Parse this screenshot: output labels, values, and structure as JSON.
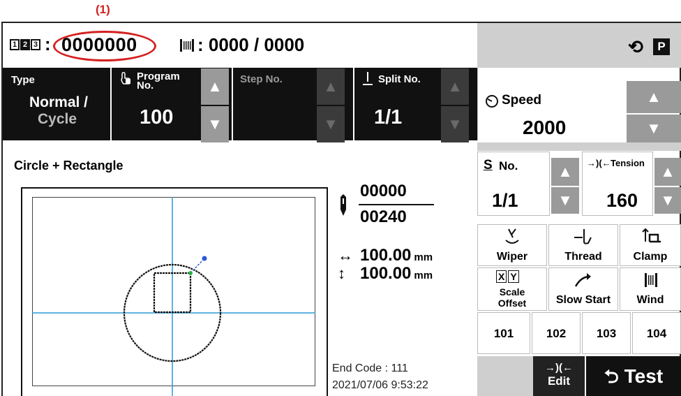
{
  "callout": "(1)",
  "header": {
    "counter_icon_digits": [
      "1",
      "2",
      "3"
    ],
    "colon": ":",
    "counter_value": "0000000",
    "bobbin_value": ": 0000 / 0000",
    "cycle_icon": "⟲",
    "p_icon": "P"
  },
  "cells": {
    "type_label": "Type",
    "type_value_1": "Normal /",
    "type_value_2": "Cycle",
    "program_label_1": "Program",
    "program_label_2": "No.",
    "program_value": "100",
    "step_label": "Step No.",
    "split_label": "Split No.",
    "split_value": "1/1"
  },
  "pattern": {
    "title": "Circle + Rectangle",
    "stitch_current": "00000",
    "stitch_total": "00240",
    "width_value": "100.00",
    "height_value": "100.00",
    "unit": "mm",
    "end_code": "End Code : 111",
    "timestamp": "2021/07/06  9:53:22"
  },
  "right": {
    "speed_label": "Speed",
    "speed_value": "2000",
    "sno_label": "No.",
    "sno_value": "1/1",
    "tension_label": "Tension",
    "tension_value": "160",
    "functions": {
      "wiper": "Wiper",
      "thread": "Thread",
      "clamp": "Clamp",
      "scale_1": "Scale",
      "scale_2": "Offset",
      "slow_start": "Slow Start",
      "wind": "Wind"
    },
    "numbers": [
      "101",
      "102",
      "103",
      "104"
    ],
    "edit": "Edit",
    "test": "Test"
  },
  "icons": {
    "up": "▲",
    "down": "▼"
  }
}
